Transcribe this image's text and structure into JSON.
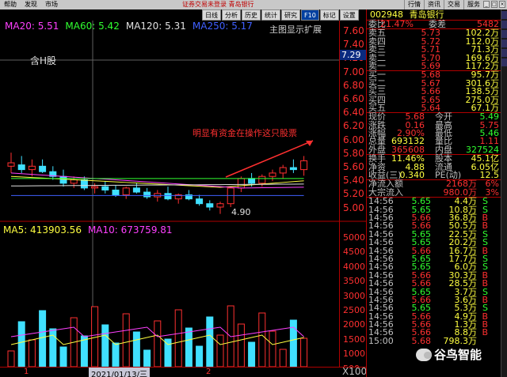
{
  "menu": [
    "帮助",
    "发现",
    "市场"
  ],
  "window_title": "证券交易未登录 青岛银行",
  "right_menu": [
    "行情",
    "资讯",
    "交易",
    "服务"
  ],
  "toolbar": [
    "日线",
    "分析",
    "历史",
    "统计",
    "研究",
    "F10",
    "标记",
    "设置"
  ],
  "toolbar_active": "F10",
  "ma": [
    {
      "label": "MA20:",
      "value": "5.51",
      "color": "#ff40ff"
    },
    {
      "label": "MA60:",
      "value": "5.42",
      "color": "#30ff30"
    },
    {
      "label": "MA120:",
      "value": "5.31",
      "color": "#e0e0e0"
    },
    {
      "label": "MA250:",
      "value": "5.17",
      "color": "#4060ff"
    }
  ],
  "show_main": "主图显示扩展",
  "h_label": "含H股",
  "annotation": "明显有资金在操作这只股票",
  "low_label": "4.90",
  "current_price_tag": "7.29",
  "vol_ma": [
    {
      "label": "MA5:",
      "value": "413903.56",
      "color": "#ffff40"
    },
    {
      "label": "MA10:",
      "value": "673759.81",
      "color": "#ff40ff"
    }
  ],
  "price_ticks": [
    "7.60",
    "7.40",
    "7.20",
    "7.00",
    "6.80",
    "6.60",
    "6.40",
    "6.20",
    "6.00",
    "5.80",
    "5.60",
    "5.40",
    "5.20",
    "5.00"
  ],
  "vol_ticks": [
    "5000",
    "4500",
    "4000",
    "3500",
    "3000",
    "2500",
    "2000",
    "1500",
    "1000",
    "500"
  ],
  "vol_unit": "X100",
  "dates": {
    "d1": "1",
    "d2": "2021/01/13/三",
    "d3": "2"
  },
  "quote": {
    "code": "002948",
    "name": "青岛银行",
    "weibi": {
      "label": "委比",
      "value": "21.47%",
      "label2": "委差",
      "value2": "5482"
    },
    "asks": [
      {
        "label": "卖五",
        "price": "5.73",
        "vol": "102.2万"
      },
      {
        "label": "卖四",
        "price": "5.72",
        "vol": "112.0万"
      },
      {
        "label": "卖三",
        "price": "5.71",
        "vol": "71.3万"
      },
      {
        "label": "卖二",
        "price": "5.70",
        "vol": "169.6万"
      },
      {
        "label": "卖一",
        "price": "5.69",
        "vol": "117.2万"
      }
    ],
    "bids": [
      {
        "label": "买一",
        "price": "5.68",
        "vol": "95.7万"
      },
      {
        "label": "买二",
        "price": "5.67",
        "vol": "301.6万"
      },
      {
        "label": "买三",
        "price": "5.66",
        "vol": "138.5万"
      },
      {
        "label": "买四",
        "price": "5.65",
        "vol": "275.0万"
      },
      {
        "label": "买五",
        "price": "5.64",
        "vol": "67.1万"
      }
    ],
    "stats": [
      {
        "l1": "现价",
        "v1": "5.68",
        "l2": "今开",
        "v2": "5.49",
        "c1": "red",
        "c2": "green"
      },
      {
        "l1": "涨跌",
        "v1": "0.16",
        "l2": "最高",
        "v2": "5.75",
        "c1": "red",
        "c2": "red"
      },
      {
        "l1": "涨幅",
        "v1": "2.90%",
        "l2": "最低",
        "v2": "5.46",
        "c1": "red",
        "c2": "green"
      },
      {
        "l1": "总量",
        "v1": "693132",
        "l2": "量比",
        "v2": "1.11",
        "c1": "yellow",
        "c2": "red"
      },
      {
        "l1": "外盘",
        "v1": "365608",
        "l2": "内盘",
        "v2": "327524",
        "c1": "red",
        "c2": "green"
      }
    ],
    "stats2": [
      {
        "l1": "换手",
        "v1": "11.46%",
        "l2": "股本",
        "v2": "45.1亿",
        "c1": "yellow",
        "c2": "yellow"
      },
      {
        "l1": "净资",
        "v1": "4.88",
        "l2": "流通",
        "v2": "6.05亿",
        "c1": "yellow",
        "c2": "yellow"
      },
      {
        "l1": "收益(三)",
        "v1": "0.340",
        "l2": "PE(动)",
        "v2": "12.5",
        "c1": "yellow",
        "c2": "yellow"
      }
    ],
    "flow": [
      {
        "label": "净流入额",
        "value": "2168万",
        "pct": "6%"
      },
      {
        "label": "大宗流入",
        "value": "980.0万",
        "pct": "3%"
      }
    ],
    "ticks": [
      {
        "t": "14:56",
        "p": "5.65",
        "v": "4.4万",
        "s": "S"
      },
      {
        "t": "14:56",
        "p": "5.65",
        "v": "10.8万",
        "s": "S"
      },
      {
        "t": "14:56",
        "p": "5.66",
        "v": "36.8万",
        "s": "B"
      },
      {
        "t": "14:56",
        "p": "5.66",
        "v": "50.5万",
        "s": "B"
      },
      {
        "t": "14:56",
        "p": "5.65",
        "v": "22.5万",
        "s": "S"
      },
      {
        "t": "14:56",
        "p": "5.65",
        "v": "20.2万",
        "s": "S"
      },
      {
        "t": "14:56",
        "p": "5.66",
        "v": "16.7万",
        "s": "B"
      },
      {
        "t": "14:56",
        "p": "5.65",
        "v": "17.7万",
        "s": "S"
      },
      {
        "t": "14:56",
        "p": "5.65",
        "v": "6.0万",
        "s": "S"
      },
      {
        "t": "14:56",
        "p": "5.66",
        "v": "30.3万",
        "s": "B"
      },
      {
        "t": "14:56",
        "p": "5.66",
        "v": "28.5万",
        "s": "B"
      },
      {
        "t": "14:56",
        "p": "5.65",
        "v": "3.7万",
        "s": "S"
      },
      {
        "t": "14:56",
        "p": "5.66",
        "v": "3.6万",
        "s": "B"
      },
      {
        "t": "14:56",
        "p": "5.65",
        "v": "5.3万",
        "s": "S"
      },
      {
        "t": "14:56",
        "p": "5.66",
        "v": "4.9万",
        "s": "B"
      },
      {
        "t": "14:56",
        "p": "5.66",
        "v": "1.3万",
        "s": "B"
      },
      {
        "t": "14:56",
        "p": "5.66",
        "v": "8.8万",
        "s": "B"
      },
      {
        "t": "15:00",
        "p": "5.68",
        "v": "798.3万",
        "s": ""
      }
    ]
  },
  "watermark": "谷鸟智能"
}
